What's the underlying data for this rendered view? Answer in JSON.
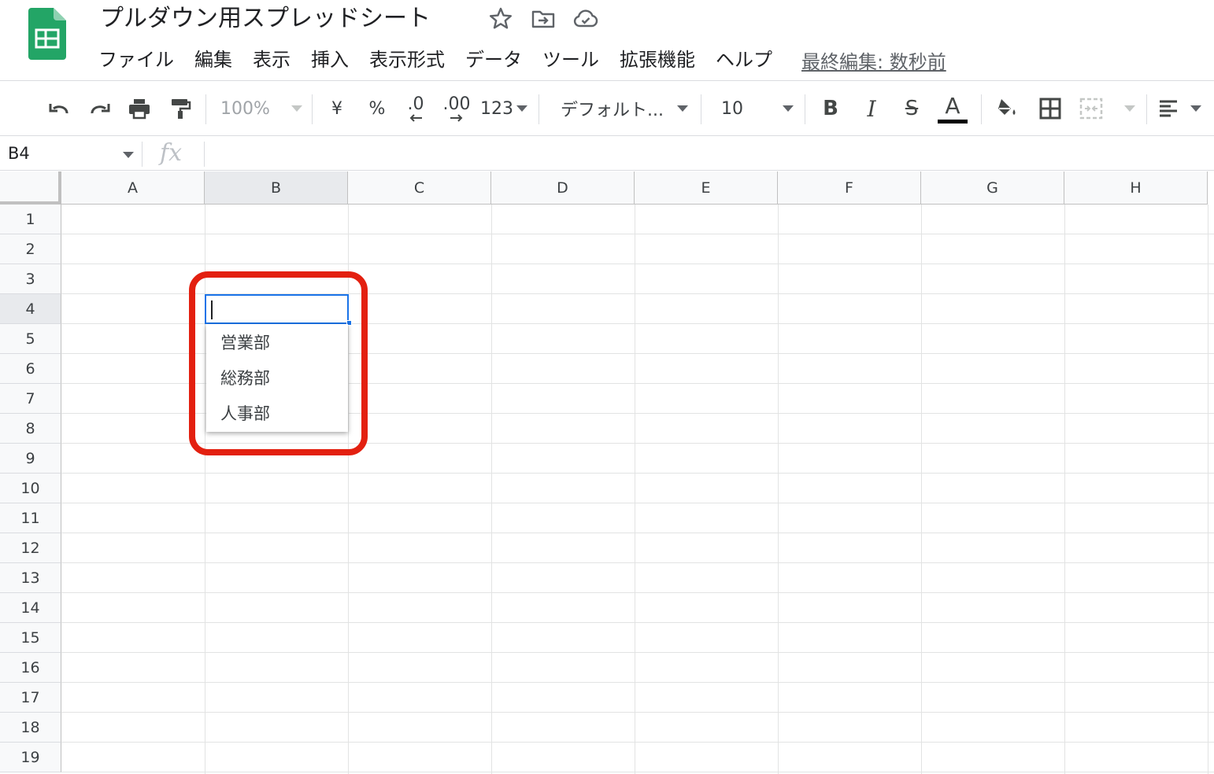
{
  "doc": {
    "title": "プルダウン用スプレッドシート",
    "menus": [
      "ファイル",
      "編集",
      "表示",
      "挿入",
      "表示形式",
      "データ",
      "ツール",
      "拡張機能",
      "ヘルプ"
    ],
    "last_edit": "最終編集: 数秒前"
  },
  "toolbar": {
    "zoom": "100%",
    "currency": "¥",
    "percent": "%",
    "dec_decrease": ".0",
    "dec_increase": ".00",
    "number_format": "123",
    "font": "デフォルト...",
    "font_size": "10",
    "bold": "B",
    "italic": "I",
    "strike": "S",
    "text_color": "A"
  },
  "formula_bar": {
    "cell_ref": "B4",
    "fx": "fx",
    "value": ""
  },
  "grid": {
    "columns": [
      "A",
      "B",
      "C",
      "D",
      "E",
      "F",
      "G",
      "H"
    ],
    "rows": [
      "1",
      "2",
      "3",
      "4",
      "5",
      "6",
      "7",
      "8",
      "9",
      "10",
      "11",
      "12",
      "13",
      "14",
      "15",
      "16",
      "17",
      "18",
      "19"
    ],
    "selected_column": "B",
    "selected_row": "4"
  },
  "dropdown": {
    "options": [
      "営業部",
      "総務部",
      "人事部"
    ]
  },
  "colors": {
    "accent": "#1a73e8",
    "highlight": "#e32010",
    "sheets_green": "#23a566"
  }
}
